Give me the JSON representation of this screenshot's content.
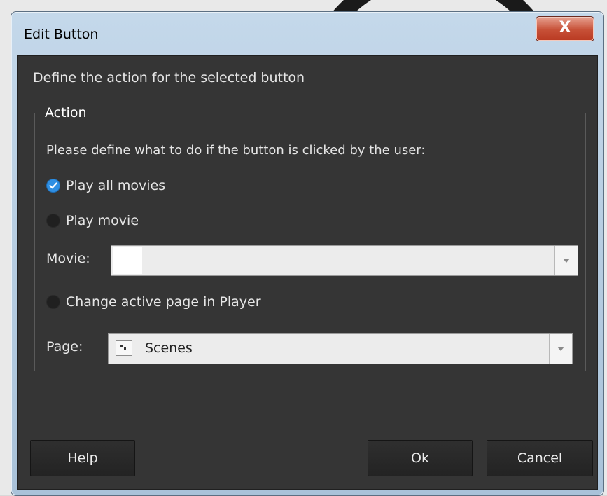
{
  "window": {
    "title": "Edit Button",
    "close_glyph": "X"
  },
  "dialog": {
    "subtitle": "Define the action for the selected button"
  },
  "action_group": {
    "legend": "Action",
    "instruction": "Please define what to do if the button is clicked by the user:",
    "options": [
      {
        "label": "Play all movies",
        "checked": true
      },
      {
        "label": "Play movie",
        "checked": false
      },
      {
        "label": "Change active page in Player",
        "checked": false
      }
    ],
    "movie_label": "Movie:",
    "movie_value": "",
    "page_label": "Page:",
    "page_value": "Scenes"
  },
  "buttons": {
    "help": "Help",
    "ok": "Ok",
    "cancel": "Cancel"
  },
  "colors": {
    "dialog_bg": "#353535",
    "checked_accent": "#2f8fe3",
    "close_red": "#c75037"
  }
}
